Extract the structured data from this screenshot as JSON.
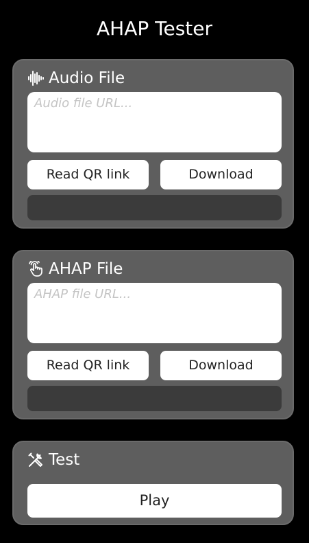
{
  "app": {
    "title": "AHAP Tester"
  },
  "audio_section": {
    "icon": "waveform-icon",
    "title": "Audio File",
    "url_placeholder": "Audio file URL...",
    "url_value": "",
    "read_qr_label": "Read QR link",
    "download_label": "Download",
    "download_progress": 0
  },
  "ahap_section": {
    "icon": "hand-tap-icon",
    "title": "AHAP File",
    "url_placeholder": "AHAP file URL...",
    "url_value": "",
    "read_qr_label": "Read QR link",
    "download_label": "Download",
    "download_progress": 0
  },
  "test_section": {
    "icon": "tools-icon",
    "title": "Test",
    "play_label": "Play"
  }
}
